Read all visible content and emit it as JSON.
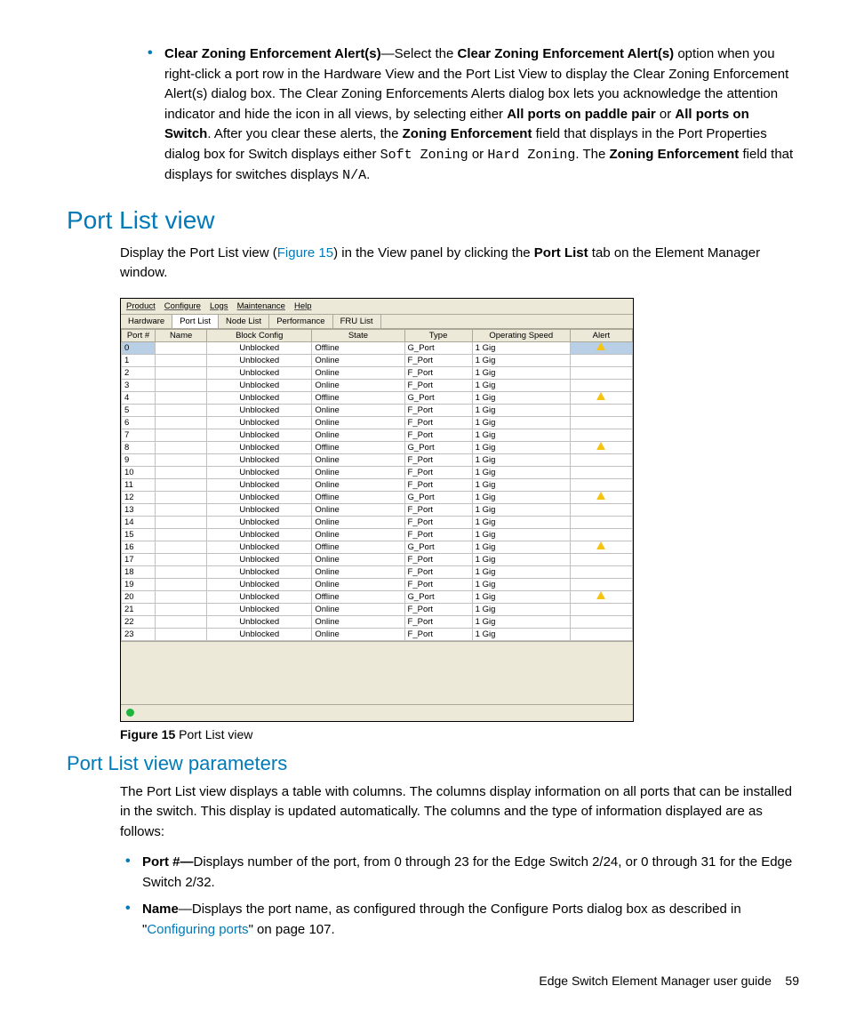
{
  "top_bullet": {
    "label": "Clear Zoning Enforcement Alert(s)",
    "text1": "—Select the ",
    "bold1": "Clear Zoning Enforcement Alert(s)",
    "text2": " option when you right-click a port row in the Hardware View and the Port List View to display the Clear Zoning Enforcement Alert(s) dialog box. The Clear Zoning Enforcements Alerts dialog box lets you acknowledge the attention indicator and hide the icon in all views, by selecting either ",
    "bold2": "All ports on paddle pair",
    "text3": " or ",
    "bold3": "All ports on Switch",
    "text4": ". After you clear these alerts, the ",
    "bold4": "Zoning Enforcement",
    "text5": " field that displays in the Port Properties dialog box for Switch displays either ",
    "mono1": "Soft Zoning",
    "text6": " or ",
    "mono2": "Hard Zoning",
    "text7": ". The ",
    "bold5": "Zoning Enforcement",
    "text8": " field that displays for switches displays ",
    "mono3": "N/A",
    "text9": "."
  },
  "h1_portlist": "Port List view",
  "portlist_intro": {
    "a": "Display the Port List view (",
    "figref": "Figure 15",
    "b": ") in the View panel by clicking the ",
    "bold": "Port List",
    "c": " tab on the Element Manager window."
  },
  "screenshot": {
    "menus": [
      "Product",
      "Configure",
      "Logs",
      "Maintenance",
      "Help"
    ],
    "tabs": [
      "Hardware",
      "Port List",
      "Node List",
      "Performance",
      "FRU List"
    ],
    "active_tab_index": 1,
    "columns": [
      "Port #",
      "Name",
      "Block Config",
      "State",
      "Type",
      "Operating Speed",
      "Alert"
    ],
    "rows": [
      {
        "port": "0",
        "name": "",
        "block": "Unblocked",
        "state": "Offline",
        "type": "G_Port",
        "speed": "1 Gig",
        "alert": true,
        "selected": true
      },
      {
        "port": "1",
        "name": "",
        "block": "Unblocked",
        "state": "Online",
        "type": "F_Port",
        "speed": "1 Gig",
        "alert": false
      },
      {
        "port": "2",
        "name": "",
        "block": "Unblocked",
        "state": "Online",
        "type": "F_Port",
        "speed": "1 Gig",
        "alert": false
      },
      {
        "port": "3",
        "name": "",
        "block": "Unblocked",
        "state": "Online",
        "type": "F_Port",
        "speed": "1 Gig",
        "alert": false
      },
      {
        "port": "4",
        "name": "",
        "block": "Unblocked",
        "state": "Offline",
        "type": "G_Port",
        "speed": "1 Gig",
        "alert": true
      },
      {
        "port": "5",
        "name": "",
        "block": "Unblocked",
        "state": "Online",
        "type": "F_Port",
        "speed": "1 Gig",
        "alert": false
      },
      {
        "port": "6",
        "name": "",
        "block": "Unblocked",
        "state": "Online",
        "type": "F_Port",
        "speed": "1 Gig",
        "alert": false
      },
      {
        "port": "7",
        "name": "",
        "block": "Unblocked",
        "state": "Online",
        "type": "F_Port",
        "speed": "1 Gig",
        "alert": false
      },
      {
        "port": "8",
        "name": "",
        "block": "Unblocked",
        "state": "Offline",
        "type": "G_Port",
        "speed": "1 Gig",
        "alert": true
      },
      {
        "port": "9",
        "name": "",
        "block": "Unblocked",
        "state": "Online",
        "type": "F_Port",
        "speed": "1 Gig",
        "alert": false
      },
      {
        "port": "10",
        "name": "",
        "block": "Unblocked",
        "state": "Online",
        "type": "F_Port",
        "speed": "1 Gig",
        "alert": false
      },
      {
        "port": "11",
        "name": "",
        "block": "Unblocked",
        "state": "Online",
        "type": "F_Port",
        "speed": "1 Gig",
        "alert": false
      },
      {
        "port": "12",
        "name": "",
        "block": "Unblocked",
        "state": "Offline",
        "type": "G_Port",
        "speed": "1 Gig",
        "alert": true
      },
      {
        "port": "13",
        "name": "",
        "block": "Unblocked",
        "state": "Online",
        "type": "F_Port",
        "speed": "1 Gig",
        "alert": false
      },
      {
        "port": "14",
        "name": "",
        "block": "Unblocked",
        "state": "Online",
        "type": "F_Port",
        "speed": "1 Gig",
        "alert": false
      },
      {
        "port": "15",
        "name": "",
        "block": "Unblocked",
        "state": "Online",
        "type": "F_Port",
        "speed": "1 Gig",
        "alert": false
      },
      {
        "port": "16",
        "name": "",
        "block": "Unblocked",
        "state": "Offline",
        "type": "G_Port",
        "speed": "1 Gig",
        "alert": true
      },
      {
        "port": "17",
        "name": "",
        "block": "Unblocked",
        "state": "Online",
        "type": "F_Port",
        "speed": "1 Gig",
        "alert": false
      },
      {
        "port": "18",
        "name": "",
        "block": "Unblocked",
        "state": "Online",
        "type": "F_Port",
        "speed": "1 Gig",
        "alert": false
      },
      {
        "port": "19",
        "name": "",
        "block": "Unblocked",
        "state": "Online",
        "type": "F_Port",
        "speed": "1 Gig",
        "alert": false
      },
      {
        "port": "20",
        "name": "",
        "block": "Unblocked",
        "state": "Offline",
        "type": "G_Port",
        "speed": "1 Gig",
        "alert": true
      },
      {
        "port": "21",
        "name": "",
        "block": "Unblocked",
        "state": "Online",
        "type": "F_Port",
        "speed": "1 Gig",
        "alert": false
      },
      {
        "port": "22",
        "name": "",
        "block": "Unblocked",
        "state": "Online",
        "type": "F_Port",
        "speed": "1 Gig",
        "alert": false
      },
      {
        "port": "23",
        "name": "",
        "block": "Unblocked",
        "state": "Online",
        "type": "F_Port",
        "speed": "1 Gig",
        "alert": false
      }
    ]
  },
  "figure_caption": {
    "num": "Figure 15",
    "text": "  Port List view"
  },
  "h2_params": "Port List view parameters",
  "params_intro": "The Port List view displays a table with columns. The columns display information on all ports that can be installed in the switch. This display is updated automatically. The columns and the type of information displayed are as follows:",
  "param_bullets": {
    "item0": {
      "label": "Port #—",
      "text": "Displays number of the port, from 0 through 23 for the Edge Switch 2/24, or 0 through 31 for the Edge Switch 2/32."
    },
    "item1": {
      "label": "Name",
      "dash": "—Displays the port name, as configured through the Configure Ports dialog box as described in \"",
      "link": "Configuring ports",
      "tail": "\" on page 107."
    }
  },
  "footer": {
    "title": "Edge Switch Element Manager user guide",
    "page": "59"
  }
}
